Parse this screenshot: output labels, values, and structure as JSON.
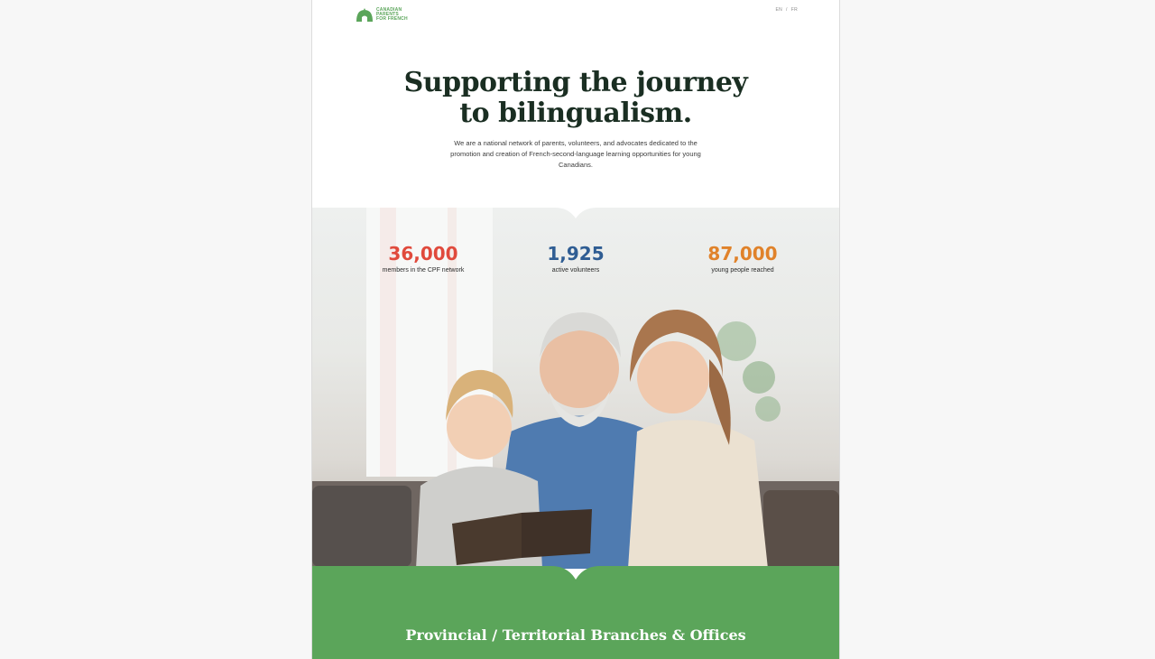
{
  "header": {
    "logo_lines": [
      "CANADIAN",
      "PARENTS",
      "FOR FRENCH"
    ],
    "lang_en": "EN",
    "lang_sep": "/",
    "lang_fr": "FR"
  },
  "hero": {
    "headline_line1": "Supporting the journey",
    "headline_line2": "to bilingualism.",
    "intro": "We are a national network of parents, volunteers, and advocates dedicated to the promotion and creation of French-second-language learning opportunities for young Canadians."
  },
  "stats": [
    {
      "value": "36,000",
      "label": "members in the CPF network",
      "color": "#e04a3c"
    },
    {
      "value": "1,925",
      "label": "active volunteers",
      "color": "#2f5d93"
    },
    {
      "value": "87,000",
      "label": "young people reached",
      "color": "#e0822a"
    }
  ],
  "photo": {
    "icon": "family-reading-photo"
  },
  "branches": {
    "title": "Provincial / Territorial Branches & Offices"
  },
  "colors": {
    "brand_green": "#5ba55a",
    "headline": "#1a2e22"
  }
}
